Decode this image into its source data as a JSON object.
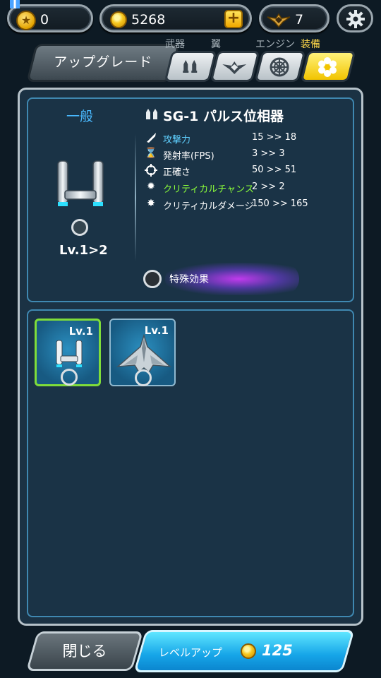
{
  "resources": {
    "medals": "0",
    "coins": "5268",
    "rank_points": "7"
  },
  "tabs": {
    "upgrade": "アップグレード",
    "weapons": "武器",
    "wings": "翼",
    "engine": "エンジン",
    "equipment": "装備"
  },
  "item": {
    "rank": "一般",
    "level": "Lv.1>2",
    "name": "SG-1 パルス位相器"
  },
  "stats": [
    {
      "label": "攻撃力",
      "value": "15 >> 18",
      "icon": "bullet-icon"
    },
    {
      "label": "発射率(FPS)",
      "value": "3 >> 3",
      "icon": "hourglass-icon"
    },
    {
      "label": "正確さ",
      "value": "50 >> 51",
      "icon": "crosshair-icon"
    },
    {
      "label": "クリティカルチャンス",
      "value": "2 >> 2",
      "icon": "burst-outline-icon"
    },
    {
      "label": "クリティカルダメージ",
      "value": "150 >> 165",
      "icon": "burst-icon"
    }
  ],
  "special": "特殊効果",
  "inventory": [
    {
      "level": "Lv.1",
      "icon": "pulse-phaser-icon"
    },
    {
      "level": "Lv.1",
      "icon": "jet-fighter-icon"
    }
  ],
  "buttons": {
    "close": "閉じる",
    "levelup": "レベルアップ",
    "levelup_cost": "125"
  },
  "colors": {
    "stat_highlight_blue": "#5fd0ff",
    "stat_highlight_green": "#8cff3a",
    "active_tab": "#f2c400",
    "levelup_button": "#16a5e8",
    "selected_item_border": "#7fdd3a"
  }
}
